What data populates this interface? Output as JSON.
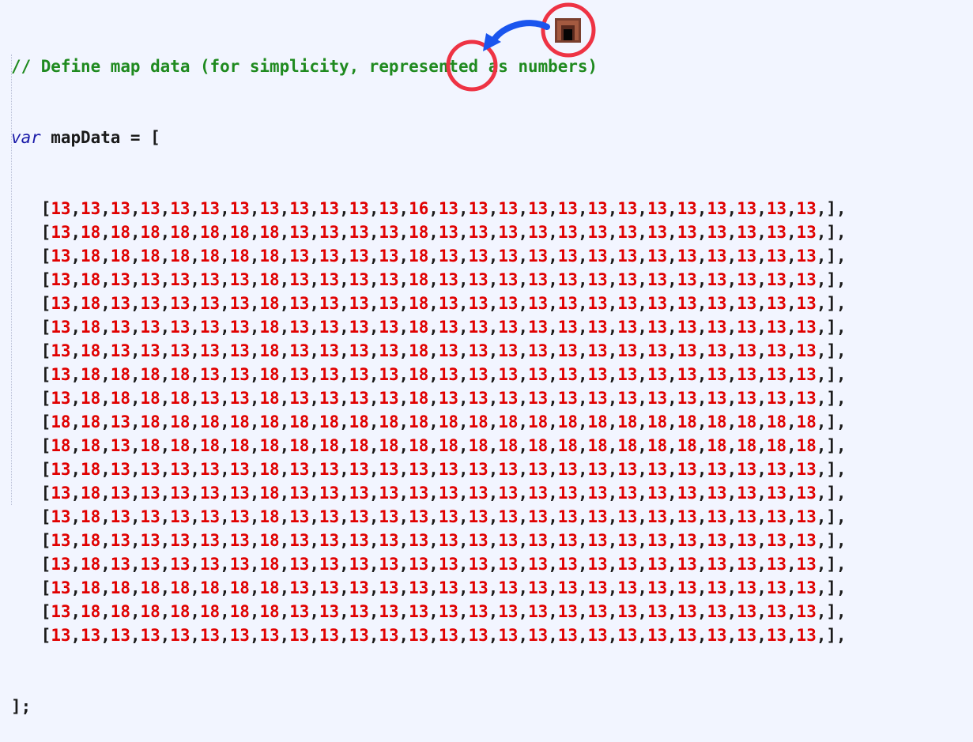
{
  "code": {
    "comment": "// Define map data (for simplicity, represented as numbers)",
    "keyword": "var",
    "declaration": " mapData = [",
    "closing": "];",
    "rows": [
      [
        "13",
        "13",
        "13",
        "13",
        "13",
        "13",
        "13",
        "13",
        "13",
        "13",
        "13",
        "13",
        "16",
        "13",
        "13",
        "13",
        "13",
        "13",
        "13",
        "13",
        "13",
        "13",
        "13",
        "13",
        "13",
        "13"
      ],
      [
        "13",
        "18",
        "18",
        "18",
        "18",
        "18",
        "18",
        "18",
        "13",
        "13",
        "13",
        "13",
        "18",
        "13",
        "13",
        "13",
        "13",
        "13",
        "13",
        "13",
        "13",
        "13",
        "13",
        "13",
        "13",
        "13"
      ],
      [
        "13",
        "18",
        "18",
        "18",
        "18",
        "18",
        "18",
        "18",
        "13",
        "13",
        "13",
        "13",
        "18",
        "13",
        "13",
        "13",
        "13",
        "13",
        "13",
        "13",
        "13",
        "13",
        "13",
        "13",
        "13",
        "13"
      ],
      [
        "13",
        "18",
        "13",
        "13",
        "13",
        "13",
        "13",
        "18",
        "13",
        "13",
        "13",
        "13",
        "18",
        "13",
        "13",
        "13",
        "13",
        "13",
        "13",
        "13",
        "13",
        "13",
        "13",
        "13",
        "13",
        "13"
      ],
      [
        "13",
        "18",
        "13",
        "13",
        "13",
        "13",
        "13",
        "18",
        "13",
        "13",
        "13",
        "13",
        "18",
        "13",
        "13",
        "13",
        "13",
        "13",
        "13",
        "13",
        "13",
        "13",
        "13",
        "13",
        "13",
        "13"
      ],
      [
        "13",
        "18",
        "13",
        "13",
        "13",
        "13",
        "13",
        "18",
        "13",
        "13",
        "13",
        "13",
        "18",
        "13",
        "13",
        "13",
        "13",
        "13",
        "13",
        "13",
        "13",
        "13",
        "13",
        "13",
        "13",
        "13"
      ],
      [
        "13",
        "18",
        "13",
        "13",
        "13",
        "13",
        "13",
        "18",
        "13",
        "13",
        "13",
        "13",
        "18",
        "13",
        "13",
        "13",
        "13",
        "13",
        "13",
        "13",
        "13",
        "13",
        "13",
        "13",
        "13",
        "13"
      ],
      [
        "13",
        "18",
        "18",
        "18",
        "18",
        "13",
        "13",
        "18",
        "13",
        "13",
        "13",
        "13",
        "18",
        "13",
        "13",
        "13",
        "13",
        "13",
        "13",
        "13",
        "13",
        "13",
        "13",
        "13",
        "13",
        "13"
      ],
      [
        "13",
        "18",
        "18",
        "18",
        "18",
        "13",
        "13",
        "18",
        "13",
        "13",
        "13",
        "13",
        "18",
        "13",
        "13",
        "13",
        "13",
        "13",
        "13",
        "13",
        "13",
        "13",
        "13",
        "13",
        "13",
        "13"
      ],
      [
        "18",
        "18",
        "13",
        "18",
        "18",
        "18",
        "18",
        "18",
        "18",
        "18",
        "18",
        "18",
        "18",
        "18",
        "18",
        "18",
        "18",
        "18",
        "18",
        "18",
        "18",
        "18",
        "18",
        "18",
        "18",
        "18"
      ],
      [
        "18",
        "18",
        "13",
        "18",
        "18",
        "18",
        "18",
        "18",
        "18",
        "18",
        "18",
        "18",
        "18",
        "18",
        "18",
        "18",
        "18",
        "18",
        "18",
        "18",
        "18",
        "18",
        "18",
        "18",
        "18",
        "18"
      ],
      [
        "13",
        "18",
        "13",
        "13",
        "13",
        "13",
        "13",
        "18",
        "13",
        "13",
        "13",
        "13",
        "13",
        "13",
        "13",
        "13",
        "13",
        "13",
        "13",
        "13",
        "13",
        "13",
        "13",
        "13",
        "13",
        "13"
      ],
      [
        "13",
        "18",
        "13",
        "13",
        "13",
        "13",
        "13",
        "18",
        "13",
        "13",
        "13",
        "13",
        "13",
        "13",
        "13",
        "13",
        "13",
        "13",
        "13",
        "13",
        "13",
        "13",
        "13",
        "13",
        "13",
        "13"
      ],
      [
        "13",
        "18",
        "13",
        "13",
        "13",
        "13",
        "13",
        "18",
        "13",
        "13",
        "13",
        "13",
        "13",
        "13",
        "13",
        "13",
        "13",
        "13",
        "13",
        "13",
        "13",
        "13",
        "13",
        "13",
        "13",
        "13"
      ],
      [
        "13",
        "18",
        "13",
        "13",
        "13",
        "13",
        "13",
        "18",
        "13",
        "13",
        "13",
        "13",
        "13",
        "13",
        "13",
        "13",
        "13",
        "13",
        "13",
        "13",
        "13",
        "13",
        "13",
        "13",
        "13",
        "13"
      ],
      [
        "13",
        "18",
        "13",
        "13",
        "13",
        "13",
        "13",
        "18",
        "13",
        "13",
        "13",
        "13",
        "13",
        "13",
        "13",
        "13",
        "13",
        "13",
        "13",
        "13",
        "13",
        "13",
        "13",
        "13",
        "13",
        "13"
      ],
      [
        "13",
        "18",
        "18",
        "18",
        "18",
        "18",
        "18",
        "18",
        "13",
        "13",
        "13",
        "13",
        "13",
        "13",
        "13",
        "13",
        "13",
        "13",
        "13",
        "13",
        "13",
        "13",
        "13",
        "13",
        "13",
        "13"
      ],
      [
        "13",
        "18",
        "18",
        "18",
        "18",
        "18",
        "18",
        "18",
        "13",
        "13",
        "13",
        "13",
        "13",
        "13",
        "13",
        "13",
        "13",
        "13",
        "13",
        "13",
        "13",
        "13",
        "13",
        "13",
        "13",
        "13"
      ],
      [
        "13",
        "13",
        "13",
        "13",
        "13",
        "13",
        "13",
        "13",
        "13",
        "13",
        "13",
        "13",
        "13",
        "13",
        "13",
        "13",
        "13",
        "13",
        "13",
        "13",
        "13",
        "13",
        "13",
        "13",
        "13",
        "13"
      ]
    ]
  },
  "annotation": {
    "icon": "door-tile-icon",
    "highlighted_value": "16",
    "circle_color": "#ee3344",
    "arrow_color": "#1a55ee",
    "door_color": "#8a4a36"
  },
  "colors": {
    "background": "#f2f5ff",
    "comment": "#1f8a1f",
    "keyword": "#1a1aa8",
    "number": "#e00000"
  }
}
